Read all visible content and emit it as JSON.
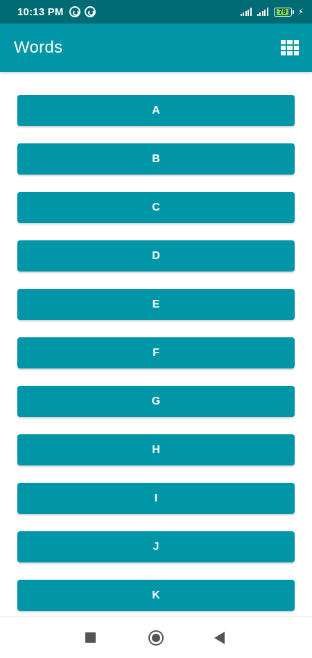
{
  "status_bar": {
    "time": "10:13 PM",
    "battery_level": "79"
  },
  "app_bar": {
    "title": "Words"
  },
  "letters": [
    "A",
    "B",
    "C",
    "D",
    "E",
    "F",
    "G",
    "H",
    "I",
    "J",
    "K"
  ],
  "colors": {
    "primary": "#0096a7",
    "primary_dark": "#006b73",
    "nav_icons": "#555555"
  },
  "icons": {
    "layout_toggle": "grid-icon",
    "nav_recents": "square-icon",
    "nav_home": "circle-icon",
    "nav_back": "triangle-back-icon"
  }
}
